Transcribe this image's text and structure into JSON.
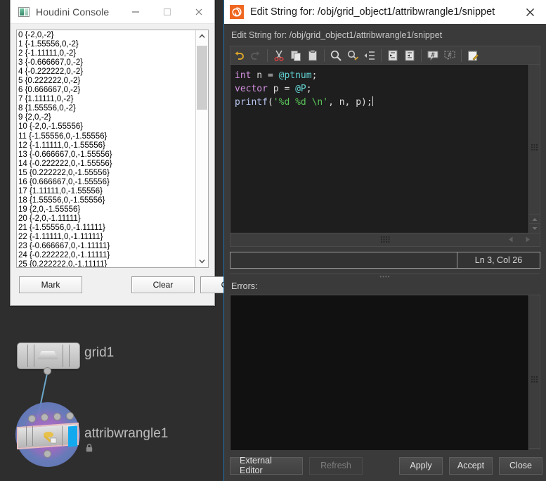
{
  "console_window": {
    "title": "Houdini Console",
    "icon": "console-window-icon",
    "window_controls": {
      "minimize": "minimize-icon",
      "maximize": "maximize-icon",
      "close": "close-icon"
    },
    "lines": [
      "0 {-2,0,-2}",
      "1 {-1.55556,0,-2}",
      "2 {-1.11111,0,-2}",
      "3 {-0.666667,0,-2}",
      "4 {-0.222222,0,-2}",
      "5 {0.222222,0,-2}",
      "6 {0.666667,0,-2}",
      "7 {1.11111,0,-2}",
      "8 {1.55556,0,-2}",
      "9 {2,0,-2}",
      "10 {-2,0,-1.55556}",
      "11 {-1.55556,0,-1.55556}",
      "12 {-1.11111,0,-1.55556}",
      "13 {-0.666667,0,-1.55556}",
      "14 {-0.222222,0,-1.55556}",
      "15 {0.222222,0,-1.55556}",
      "16 {0.666667,0,-1.55556}",
      "17 {1.11111,0,-1.55556}",
      "18 {1.55556,0,-1.55556}",
      "19 {2,0,-1.55556}",
      "20 {-2,0,-1.11111}",
      "21 {-1.55556,0,-1.11111}",
      "22 {-1.11111,0,-1.11111}",
      "23 {-0.666667,0,-1.11111}",
      "24 {-0.222222,0,-1.11111}",
      "25 {0.222222,0,-1.11111}"
    ],
    "buttons": {
      "mark": "Mark",
      "clear": "Clear",
      "close": "Close"
    }
  },
  "node_graph": {
    "nodes": [
      {
        "name": "grid1",
        "type": "grid"
      },
      {
        "name": "attribwrangle1",
        "type": "attribwrangle",
        "locked": true,
        "lock_icon": "lock-icon"
      }
    ]
  },
  "dialog": {
    "title": "Edit String for: /obj/grid_object1/attribwrangle1/snippet",
    "subtitle": "Edit String for: /obj/grid_object1/attribwrangle1/snippet",
    "app_icon": "houdini-logo-icon",
    "close_icon": "close-icon",
    "toolbar": [
      {
        "name": "undo-icon",
        "label": "Undo",
        "enabled": true
      },
      {
        "name": "redo-icon",
        "label": "Redo",
        "enabled": false
      },
      {
        "name": "cut-icon",
        "label": "Cut",
        "enabled": true
      },
      {
        "name": "copy-icon",
        "label": "Copy",
        "enabled": true
      },
      {
        "name": "paste-icon",
        "label": "Paste",
        "enabled": true
      },
      {
        "name": "find-icon",
        "label": "Find",
        "enabled": true
      },
      {
        "name": "find-replace-icon",
        "label": "Find and Replace",
        "enabled": true
      },
      {
        "name": "go-to-line-icon",
        "label": "Go to Line",
        "enabled": true
      },
      {
        "name": "indent-icon",
        "label": "Indent",
        "enabled": true
      },
      {
        "name": "unindent-icon",
        "label": "Unindent",
        "enabled": true
      },
      {
        "name": "comment-icon",
        "label": "Comment",
        "enabled": true
      },
      {
        "name": "uncomment-icon",
        "label": "Uncomment",
        "enabled": true
      },
      {
        "name": "edit-notes-icon",
        "label": "Edit Notes",
        "enabled": true
      }
    ],
    "code": {
      "lines": [
        [
          {
            "t": "int",
            "c": "type"
          },
          {
            "t": " n = ",
            "c": "plain"
          },
          {
            "t": "@ptnum",
            "c": "attr"
          },
          {
            "t": ";",
            "c": "plain"
          }
        ],
        [
          {
            "t": "vector",
            "c": "type"
          },
          {
            "t": " p = ",
            "c": "plain"
          },
          {
            "t": "@P",
            "c": "attr"
          },
          {
            "t": ";",
            "c": "plain"
          }
        ],
        [
          {
            "t": "printf",
            "c": "func"
          },
          {
            "t": "(",
            "c": "plain"
          },
          {
            "t": "'%d %d \\n'",
            "c": "str"
          },
          {
            "t": ", n, p);",
            "c": "plain"
          }
        ]
      ]
    },
    "status": {
      "message": "",
      "line_col": "Ln 3, Col 26"
    },
    "errors_label": "Errors:",
    "errors_content": "",
    "footer_buttons": [
      {
        "label": "External Editor",
        "enabled": true,
        "name": "external-editor-button"
      },
      {
        "label": "Refresh",
        "enabled": false,
        "name": "refresh-button"
      },
      {
        "label": "Apply",
        "enabled": true,
        "name": "apply-button"
      },
      {
        "label": "Accept",
        "enabled": true,
        "name": "accept-button"
      },
      {
        "label": "Close",
        "enabled": true,
        "name": "close-button"
      }
    ]
  },
  "colors": {
    "houdini_orange": "#ef6721",
    "dialog_bg": "#3a3a3a",
    "code_bg": "#1e1e1e",
    "accent_blue": "#13a9ef",
    "wire": "#6aa6c8"
  }
}
